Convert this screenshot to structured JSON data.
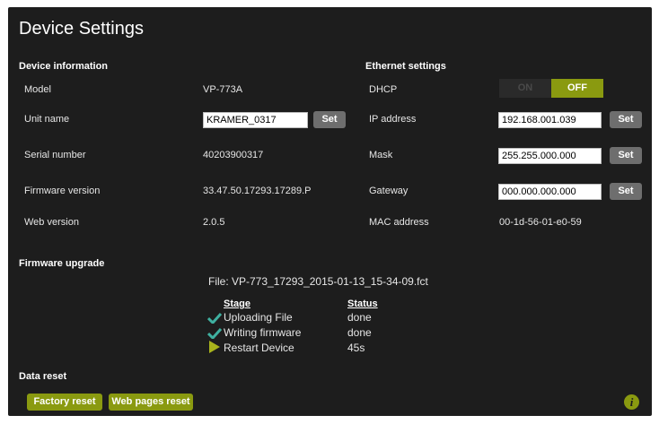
{
  "page": {
    "title": "Device Settings"
  },
  "device_info": {
    "heading": "Device information",
    "rows": [
      {
        "label": "Model",
        "value": "VP-773A"
      },
      {
        "label": "Unit name",
        "value": "KRAMER_0317",
        "button": "Set"
      },
      {
        "label": "Serial number",
        "value": "40203900317"
      },
      {
        "label": "Firmware version",
        "value": "33.47.50.17293.17289.P"
      },
      {
        "label": "Web version",
        "value": "2.0.5"
      }
    ]
  },
  "ethernet": {
    "heading": "Ethernet settings",
    "dhcp": {
      "label": "DHCP",
      "on_label": "ON",
      "off_label": "OFF",
      "state": "OFF"
    },
    "ip": {
      "label": "IP address",
      "value": "192.168.001.039",
      "button": "Set"
    },
    "mask": {
      "label": "Mask",
      "value": "255.255.000.000",
      "button": "Set"
    },
    "gateway": {
      "label": "Gateway",
      "value": "000.000.000.000",
      "button": "Set"
    },
    "mac": {
      "label": "MAC address",
      "value": "00-1d-56-01-e0-59"
    }
  },
  "firmware_upgrade": {
    "heading": "Firmware upgrade",
    "file": "File:  VP-773_17293_2015-01-13_15-34-09.fct",
    "stage_header": "Stage",
    "status_header": "Status",
    "steps": [
      {
        "stage": "Uploading File",
        "status": "done",
        "icon": "check-icon"
      },
      {
        "stage": "Writing firmware",
        "status": "done",
        "icon": "check-icon"
      },
      {
        "stage": "Restart Device",
        "status": "45s",
        "icon": "play-arrow-icon"
      }
    ]
  },
  "data_reset": {
    "heading": "Data reset",
    "factory_reset": "Factory reset",
    "web_pages_reset": "Web pages reset"
  },
  "info": {
    "icon": "info-icon",
    "glyph": "i"
  },
  "colors": {
    "accent": "#8a9a10",
    "panel": "#1d1d1d",
    "set_button": "#6e6e6e",
    "check": "#3fb0a0",
    "arrow": "#a9b41c"
  }
}
